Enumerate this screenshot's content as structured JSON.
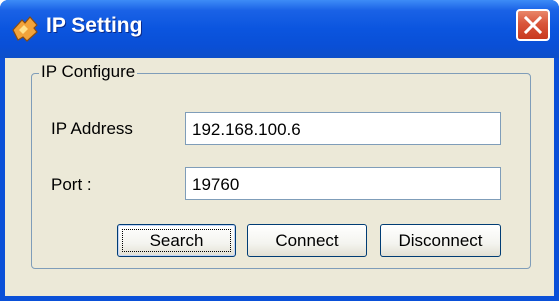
{
  "window": {
    "title": "IP Setting",
    "close_icon": "close-icon",
    "app_icon": "app-icon"
  },
  "group": {
    "label": "IP Configure"
  },
  "fields": {
    "ip_address": {
      "label": "IP Address",
      "value": "192.168.100.6"
    },
    "port": {
      "label": "Port :",
      "value": "19760"
    }
  },
  "buttons": {
    "search": "Search",
    "connect": "Connect",
    "disconnect": "Disconnect"
  },
  "colors": {
    "titlebar": "#0b55df",
    "client": "#ece9d8",
    "close": "#d9553a"
  }
}
